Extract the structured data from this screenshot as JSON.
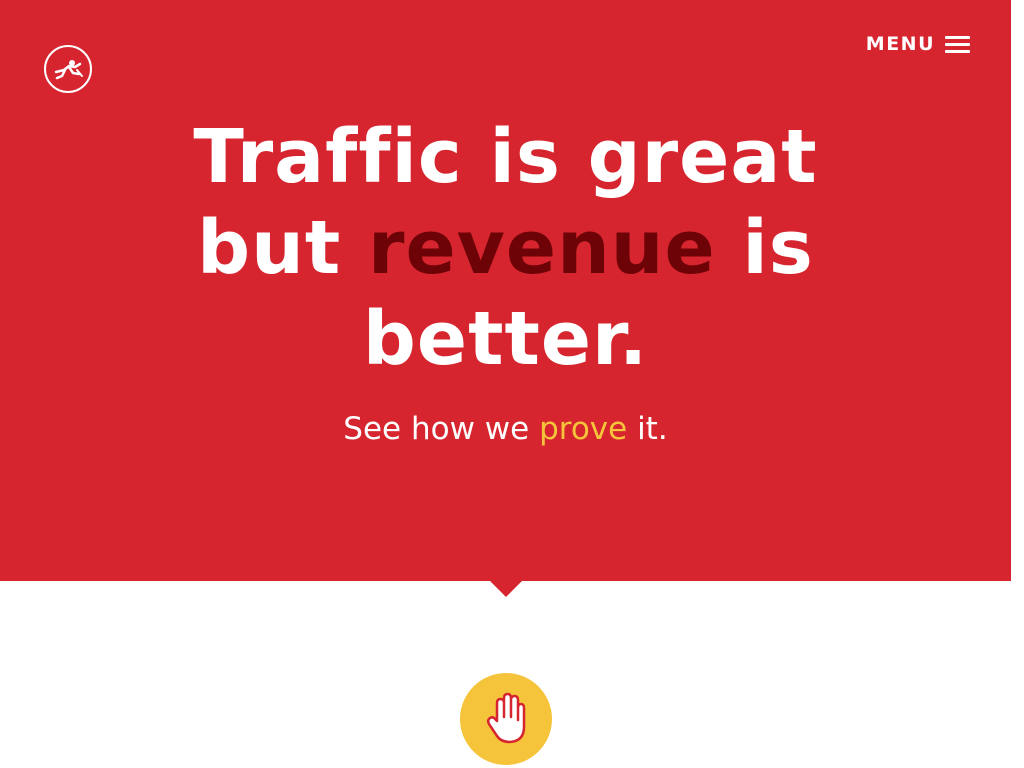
{
  "header": {
    "logo_icon": "skydiver-logo-icon",
    "menu_label": "MENU",
    "menu_icon": "hamburger-icon"
  },
  "hero": {
    "headline_part1": "Traffic is great",
    "headline_part2": "but ",
    "headline_accent": "revenue",
    "headline_part3": " is",
    "headline_part4": "better.",
    "subhead_before": "See how we ",
    "subhead_highlight": "prove",
    "subhead_after": " it."
  },
  "badge": {
    "icon": "raised-hand-icon"
  },
  "colors": {
    "hero_background": "#d6252f",
    "accent_dark_red": "#6d0306",
    "highlight_yellow": "#f5c43a",
    "white": "#ffffff"
  }
}
